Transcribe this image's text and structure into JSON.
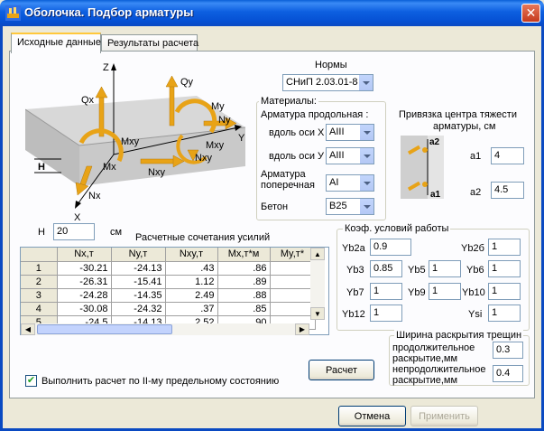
{
  "window": {
    "title": "Оболочка. Подбор арматуры",
    "close_glyph": "✕"
  },
  "tabs": [
    {
      "label": "Исходные данные"
    },
    {
      "label": "Результаты расчета"
    }
  ],
  "illustration": {
    "labels": {
      "z": "Z",
      "x": "X",
      "y": "Y",
      "qx": "Qx",
      "qy": "Qy",
      "my": "My",
      "ny": "Ny",
      "mxy_top": "Mxy",
      "mxy_right": "Mxy",
      "mx": "Mx",
      "nxy_bottom": "Nxy",
      "nxy_right": "Nxy",
      "nx": "Nx",
      "h": "H"
    }
  },
  "norms": {
    "label": "Нормы",
    "value": "СНиП 2.03.01-84"
  },
  "materials": {
    "title": "Материалы:",
    "longitudinal_label": "Арматура  продольная :",
    "along_x_label": "вдоль оси X",
    "along_x_value": "AIII",
    "along_y_label": "вдоль оси У",
    "along_y_value": "AIII",
    "transverse_label_1": "Арматура",
    "transverse_label_2": "поперечная",
    "transverse_value": "AI",
    "concrete_label": "Бетон",
    "concrete_value": "B25"
  },
  "anchor": {
    "title_1": "Привязка центра тяжести",
    "title_2": "арматуры, см",
    "a1_label": "a1",
    "a1_value": "4",
    "a2_label": "a2",
    "a2_value": "4.5",
    "img_a1": "a1",
    "img_a2": "a2"
  },
  "height": {
    "label": "H",
    "value": "20",
    "unit": "см"
  },
  "loads": {
    "title": "Расчетные сочетания усилий",
    "columns": [
      "",
      "Nx,т",
      "Ny,т",
      "Nxy,т",
      "Mx,т*м",
      "My,т*"
    ],
    "rows": [
      {
        "n": "1",
        "nx": "-30.21",
        "ny": "-24.13",
        "nxy": ".43",
        "mx": ".86"
      },
      {
        "n": "2",
        "nx": "-26.31",
        "ny": "-15.41",
        "nxy": "1.12",
        "mx": ".89"
      },
      {
        "n": "3",
        "nx": "-24.28",
        "ny": "-14.35",
        "nxy": "2.49",
        "mx": ".88"
      },
      {
        "n": "4",
        "nx": "-30.08",
        "ny": "-24.32",
        "nxy": ".37",
        "mx": ".85"
      },
      {
        "n": "5",
        "nx": "-24.5",
        "ny": "-14.13",
        "nxy": "2.52",
        "mx": ".90"
      }
    ]
  },
  "coef": {
    "title": "Коэф. условий работы",
    "yb2a_label": "Yb2a",
    "yb2a_value": "0.9",
    "yb2b_label": "Yb2б",
    "yb2b_value": "1",
    "yb3_label": "Yb3",
    "yb3_value": "0.85",
    "yb5_label": "Yb5",
    "yb5_value": "1",
    "yb6_label": "Yb6",
    "yb6_value": "1",
    "yb7_label": "Yb7",
    "yb7_value": "1",
    "yb9_label": "Yb9",
    "yb9_value": "1",
    "yb10_label": "Yb10",
    "yb10_value": "1",
    "yb12_label": "Yb12",
    "yb12_value": "1",
    "ysi_label": "Ysi",
    "ysi_value": "1"
  },
  "crack": {
    "title": "Ширина раскрытия трещин",
    "long_1": "продолжительное",
    "long_2": "раскрытие,мм",
    "long_value": "0.3",
    "short_1": "непродолжительное",
    "short_2": "раскрытие,мм",
    "short_value": "0.4"
  },
  "calc_button": "Расчет",
  "limit_state": {
    "checked_glyph": "✔",
    "label": "Выполнить расчет по II-му предельному состоянию"
  },
  "footer": {
    "cancel": "Отмена",
    "apply": "Применить"
  },
  "colors": {
    "titlebar": "#0a5fd8",
    "arrow_orange": "#e8a317"
  }
}
